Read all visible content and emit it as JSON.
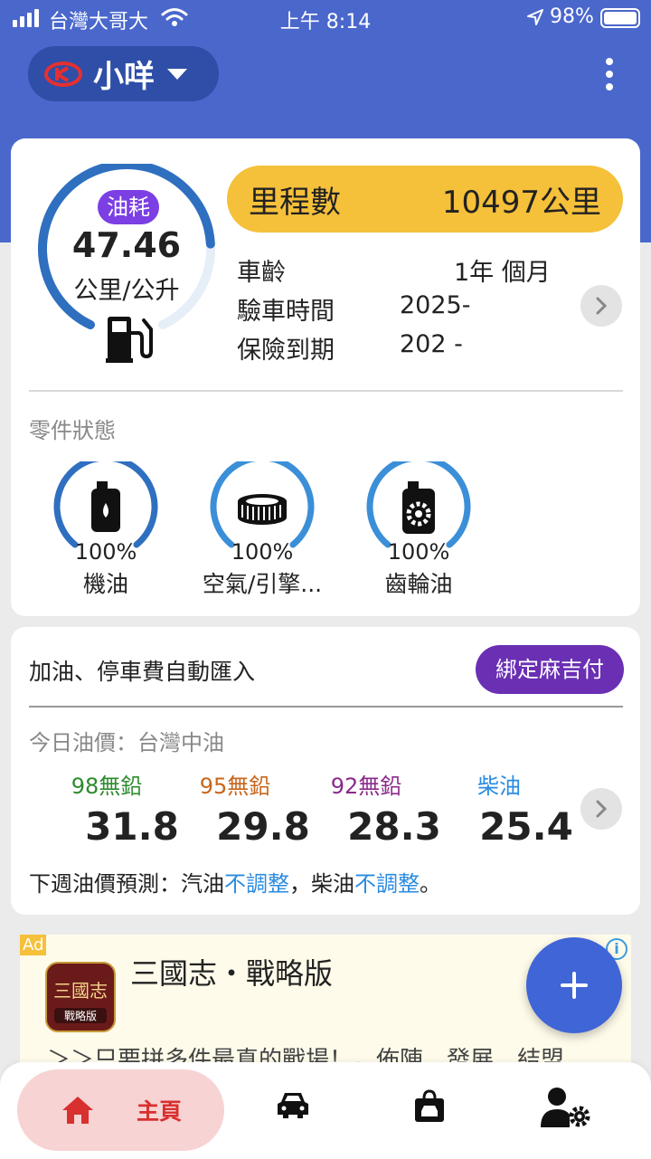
{
  "status_bar": {
    "carrier": "台灣大哥大",
    "time": "上午 8:14",
    "battery": "98%"
  },
  "header": {
    "vehicle_name": "小咩"
  },
  "fuel_economy": {
    "badge": "油耗",
    "value": "47.46",
    "unit": "公里/公升",
    "level": 0.78
  },
  "mileage": {
    "label": "里程數",
    "value": "10497公里"
  },
  "vehicle_info": [
    {
      "label": "車齡",
      "value": "1年  個月"
    },
    {
      "label": "驗車時間",
      "value": "2025-"
    },
    {
      "label": "保險到期",
      "value": "202  -"
    }
  ],
  "parts": {
    "title": "零件狀態",
    "items": [
      {
        "name": "機油",
        "percent": "100%",
        "icon": "oil-bottle-icon",
        "level": 1.0
      },
      {
        "name": "空氣/引擎...",
        "percent": "100%",
        "icon": "air-filter-icon",
        "level": 1.0
      },
      {
        "name": "齒輪油",
        "percent": "100%",
        "icon": "gear-oil-icon",
        "level": 1.0
      }
    ]
  },
  "fuel_import": {
    "title": "加油、停車費自動匯入",
    "bind_button": "綁定麻吉付"
  },
  "fuel_prices": {
    "title": "今日油價：台灣中油",
    "items": [
      {
        "type": "98無鉛",
        "price": "31.8",
        "color": "#2e8b2e"
      },
      {
        "type": "95無鉛",
        "price": "29.8",
        "color": "#c8651a"
      },
      {
        "type": "92無鉛",
        "price": "28.3",
        "color": "#8a2a8a"
      },
      {
        "type": "柴油",
        "price": "25.4",
        "color": "#2a8be0"
      }
    ],
    "forecast_prefix": "下週油價預測：汽油",
    "forecast_gas": "不調整",
    "forecast_mid": "，柴油",
    "forecast_diesel": "不調整",
    "forecast_suffix": "。"
  },
  "ad": {
    "label": "Ad",
    "icon_text": "三國志",
    "icon_sub": "戰略版",
    "title": "三國志・戰略版",
    "desc": "＞＞只要拼多件最真的戰場！，佈陣、發展、結盟"
  },
  "bottom_nav": {
    "home": "主頁"
  },
  "colors": {
    "primary": "#4a67cc",
    "accent_yellow": "#f5c03a",
    "home_active": "#d82f2f"
  }
}
